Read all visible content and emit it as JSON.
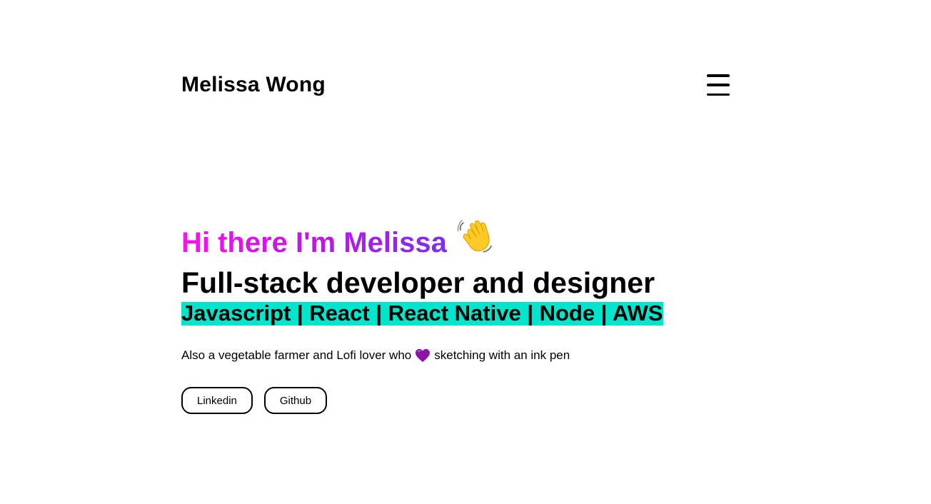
{
  "header": {
    "site_title": "Melissa Wong",
    "menu_icon": "hamburger-menu-icon"
  },
  "hero": {
    "greeting": "Hi there I'm Melissa",
    "greeting_icon": "waving-hand-icon",
    "role": "Full-stack developer and designer",
    "skills": "Javascript | React | React Native | Node | AWS",
    "bio_before": "Also a vegetable farmer and Lofi lover who",
    "bio_icon": "purple-heart-icon",
    "bio_after": "sketching with an ink pen"
  },
  "links": {
    "linkedin_label": "Linkedin",
    "github_label": "Github"
  },
  "colors": {
    "greeting_gradient_start": "#ff10f0",
    "greeting_gradient_end": "#7b2ff2",
    "skills_highlight": "#00e5cc",
    "heart": "#8a15a8"
  }
}
